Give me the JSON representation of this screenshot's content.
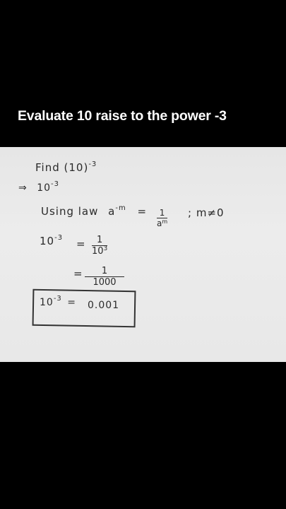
{
  "caption": "Evaluate 10 raise to the power -3",
  "notes": {
    "line1_find": "Find",
    "line1_expr": "(10)",
    "line1_exp": "-3",
    "line2_arrow": "⇒",
    "line2_base": "10",
    "line2_exp": "-3",
    "law_text": "Using law",
    "law_base": "a",
    "law_exp": "-m",
    "law_eq": "=",
    "law_num": "1",
    "law_den_base": "a",
    "law_den_exp": "m",
    "law_cond": "; m≠0",
    "step1_base": "10",
    "step1_exp": "-3",
    "step1_eq": "=",
    "step1_num": "1",
    "step1_den_base": "10",
    "step1_den_exp": "3",
    "step2_eq": "=",
    "step2_num": "1",
    "step2_den": "1000",
    "answer_base": "10",
    "answer_exp": "-3",
    "answer_eq": "=",
    "answer_value": "0.001"
  }
}
